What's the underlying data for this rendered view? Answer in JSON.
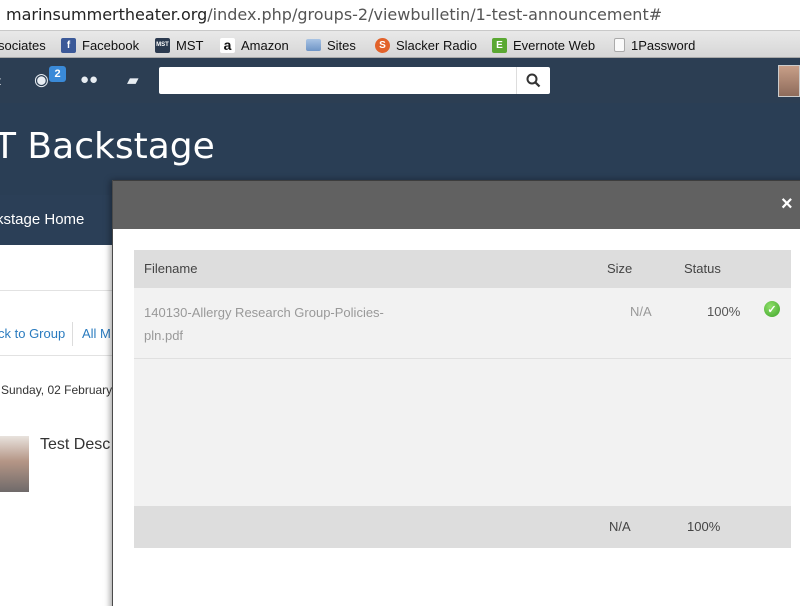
{
  "browser": {
    "url_domain": "marinsummertheater.org",
    "url_path": "/index.php/groups-2/viewbulletin/1-test-announcement#"
  },
  "bookmarks": [
    {
      "label": "sociates",
      "icon": "none"
    },
    {
      "label": "Facebook",
      "icon": "f"
    },
    {
      "label": "MST",
      "icon": "MST"
    },
    {
      "label": "Amazon",
      "icon": "a"
    },
    {
      "label": "Sites",
      "icon": "folder-icon"
    },
    {
      "label": "Slacker Radio",
      "icon": "S"
    },
    {
      "label": "Evernote Web",
      "icon": "E"
    },
    {
      "label": "1Password",
      "icon": "document-icon"
    }
  ],
  "topnav": {
    "notification_count": "2",
    "search_placeholder": "",
    "search_icon": "⚲"
  },
  "site": {
    "title": "T Backstage",
    "subnav_label": "kstage Home"
  },
  "page": {
    "back_link": "ck to Group",
    "all_link": "All M",
    "date": "Sunday, 02 February",
    "post_title": "Test Desc"
  },
  "modal": {
    "close_label": "×",
    "columns": {
      "filename": "Filename",
      "size": "Size",
      "status": "Status"
    },
    "files": [
      {
        "filename": "140130-Allergy Research Group-Policies-pln.pdf",
        "size": "N/A",
        "status": "100%",
        "status_icon": "✓"
      }
    ],
    "totals": {
      "size": "N/A",
      "status": "100%"
    }
  },
  "colors": {
    "nav_bg": "#2c3e53",
    "banner_bg": "#2a3e55",
    "modal_header": "#616161",
    "link": "#2a7bbf",
    "success": "#3ea32a"
  }
}
